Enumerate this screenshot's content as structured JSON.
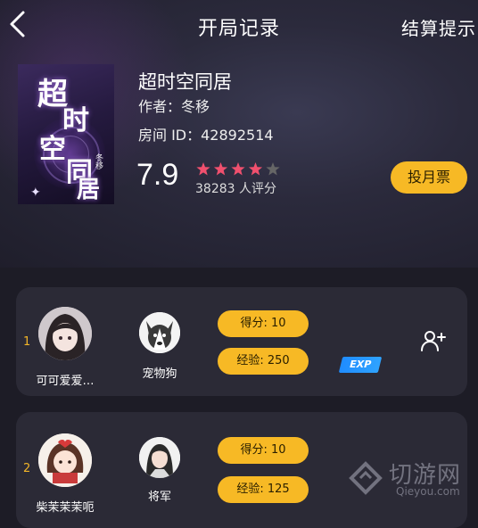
{
  "header": {
    "title": "开局记录",
    "right_action": "结算提示"
  },
  "book": {
    "cover_title_chars": [
      "超",
      "时",
      "空",
      "同",
      "居"
    ],
    "cover_author": "冬移",
    "title": "超时空同居",
    "author": "作者：冬移",
    "room_id": "房间 ID：42892514",
    "score": "7.9",
    "stars_filled": 4,
    "stars_total": 5,
    "rating_count": "38283 人评分",
    "vote_button": "投月票"
  },
  "players": [
    {
      "rank": "1",
      "name": "可可爱爱…",
      "pet_name": "宠物狗",
      "score": "得分: 10",
      "exp": "经验: 250",
      "badge": "EXP"
    },
    {
      "rank": "2",
      "name": "柴茉茉茉呃",
      "pet_name": "将军",
      "score": "得分: 10",
      "exp": "经验: 125"
    }
  ],
  "watermark": {
    "text": "切游网",
    "sub": "Qieyou.com"
  },
  "colors": {
    "accent": "#f7b925",
    "star_on": "#f0506e",
    "star_off": "#666666",
    "rank": "#f2b528",
    "exp_badge": "#1f8cff"
  }
}
